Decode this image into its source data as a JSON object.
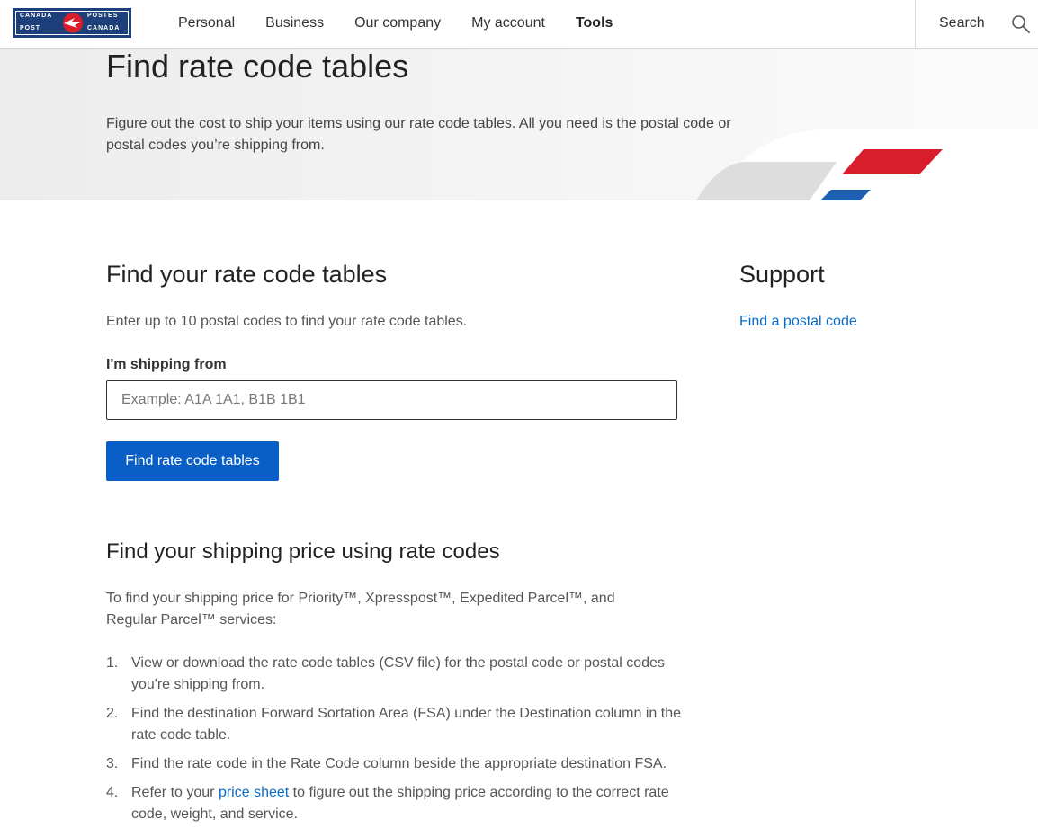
{
  "header": {
    "logo": {
      "line1_left": "CANADA",
      "line1_right": "POSTES",
      "line2_left": "POST",
      "line2_right": "CANADA"
    },
    "nav": [
      {
        "label": "Personal"
      },
      {
        "label": "Business"
      },
      {
        "label": "Our company"
      },
      {
        "label": "My account"
      },
      {
        "label": "Tools"
      }
    ],
    "search_label": "Search"
  },
  "hero": {
    "title": "Find rate code tables",
    "text": "Figure out the cost to ship your items using our rate code tables. All you need is the postal code or postal codes you’re shipping from."
  },
  "form": {
    "title": "Find your rate code tables",
    "intro": "Enter up to 10 postal codes to find your rate code tables.",
    "field_label": "I'm shipping from",
    "placeholder": "Example: A1A 1A1, B1B 1B1",
    "value": "",
    "button_label": "Find rate code tables"
  },
  "support": {
    "title": "Support",
    "link": "Find a postal code"
  },
  "pricing": {
    "title": "Find your shipping price using rate codes",
    "intro": "To find your shipping price for Priority™, Xpresspost™, Expedited Parcel™, and Regular Parcel™ services:",
    "steps": [
      {
        "num": "1.",
        "text": "View or download the rate code tables (CSV file) for the postal code or postal codes you're shipping from."
      },
      {
        "num": "2.",
        "text": "Find the destination Forward Sortation Area (FSA) under the Destination column in the rate code table."
      },
      {
        "num": "3.",
        "text": "Find the rate code in the Rate Code column beside the appropriate destination FSA."
      },
      {
        "num": "4.",
        "text_before": "Refer to your ",
        "link": "price sheet",
        "text_after": " to figure out the shipping price according to the correct rate code, weight, and service."
      }
    ]
  },
  "colors": {
    "brand_blue": "#1d3f7a",
    "brand_red": "#d81e2c",
    "button_blue": "#0a5fc6",
    "link_blue": "#0b6cc7"
  }
}
